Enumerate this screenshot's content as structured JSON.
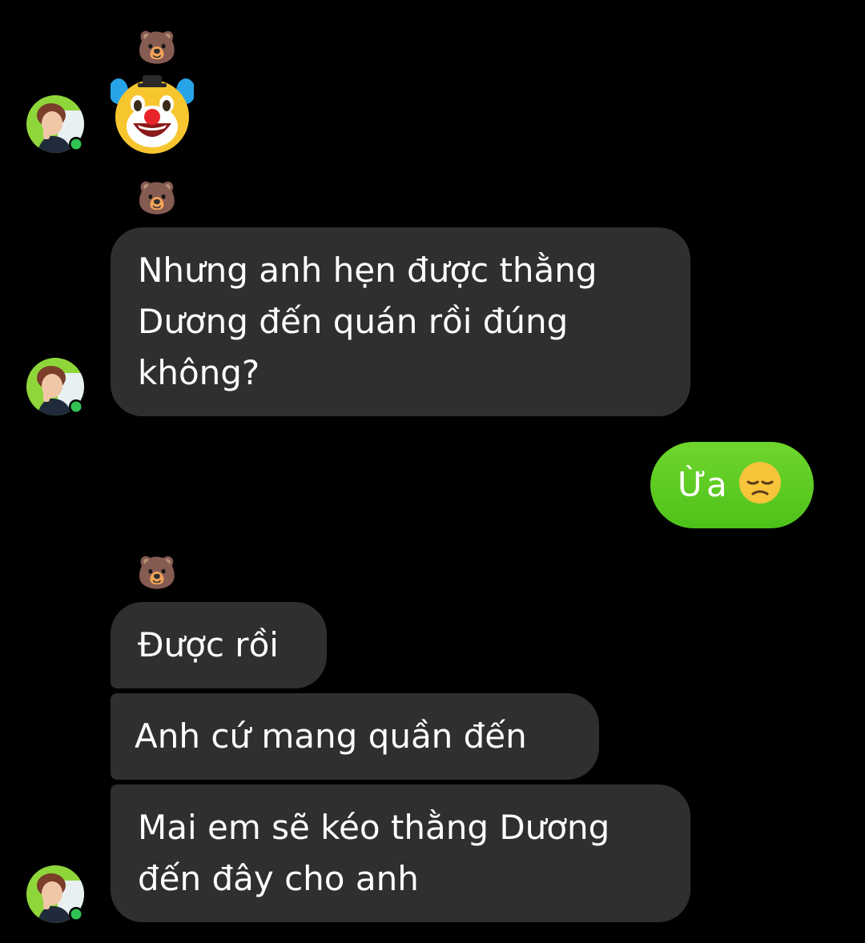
{
  "colors": {
    "background": "#000000",
    "incoming_bubble": "#2f2f2f",
    "outgoing_bubble": "#5ccd24",
    "online_dot": "#31c254",
    "text": "#ffffff"
  },
  "contact": {
    "nickname_icon": "bear-face-emoji",
    "nickname": "🐻",
    "avatar_icon": "contact-avatar",
    "online": true
  },
  "messages": [
    {
      "direction": "incoming",
      "type": "emoji",
      "content": "🤡",
      "icon": "clown-face-emoji"
    },
    {
      "direction": "incoming",
      "type": "text",
      "lines": [
        "Nhưng anh hẹn được thằng",
        "Dương đến quán rồi đúng",
        "không?"
      ]
    },
    {
      "direction": "outgoing",
      "type": "text",
      "text": "Ừa",
      "emoji": "😞",
      "emoji_icon": "disappointed-face-emoji"
    },
    {
      "direction": "incoming",
      "type": "text",
      "text": "Được rồi"
    },
    {
      "direction": "incoming",
      "type": "text",
      "text": "Anh cứ mang quần đến"
    },
    {
      "direction": "incoming",
      "type": "text",
      "lines": [
        "Mai em sẽ kéo thằng Dương",
        "đến đây cho anh"
      ]
    }
  ]
}
